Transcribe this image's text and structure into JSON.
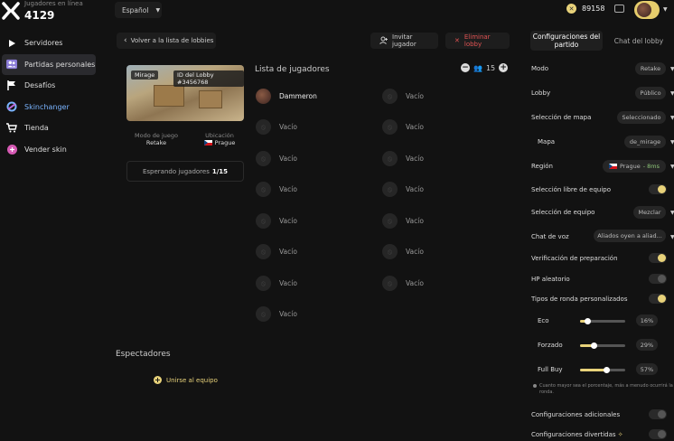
{
  "header": {
    "online_label": "Jugadores en línea",
    "online_count": "4129",
    "language": "Español",
    "coins": "89158"
  },
  "sidebar": {
    "items": [
      {
        "label": "Servidores",
        "icon": "play-icon"
      },
      {
        "label": "Partidas personales",
        "icon": "users-icon",
        "active": true
      },
      {
        "label": "Desafíos",
        "icon": "flag-icon"
      },
      {
        "label": "Skinchanger",
        "icon": "skinchanger-icon"
      },
      {
        "label": "Tienda",
        "icon": "cart-icon"
      },
      {
        "label": "Vender skin",
        "icon": "sell-skin-icon"
      }
    ]
  },
  "actions": {
    "back": "Volver a la lista de lobbies",
    "invite": "Invitar jugador",
    "delete": "Eliminar lobby"
  },
  "lobby": {
    "map": "Mirage",
    "lobby_id": "ID del Lobby #3456768",
    "mode_label": "Modo de juego",
    "mode_value": "Retake",
    "location_label": "Ubicación",
    "location_value": "Prague",
    "waiting_text": "Esperando jugadores",
    "waiting_count": "1/15"
  },
  "players": {
    "title": "Lista de jugadores",
    "max": "15",
    "filled_name": "Dammeron",
    "empty_label": "Vacío"
  },
  "spectators": {
    "title": "Espectadores",
    "join": "Unirse al equipo"
  },
  "settings": {
    "tab_active": "Configuraciones del partido",
    "tab_inactive": "Chat del lobby",
    "modo_label": "Modo",
    "modo_value": "Retake",
    "lobby_label": "Lobby",
    "lobby_value": "Público",
    "mapsel_label": "Selección de mapa",
    "mapsel_value": "Seleccionado",
    "mapa_label": "Mapa",
    "mapa_value": "de_mirage",
    "region_label": "Región",
    "region_value": "Prague",
    "region_ping": "- 8ms",
    "free_team_label": "Selección libre de equipo",
    "team_sel_label": "Selección de equipo",
    "team_sel_value": "Mezclar",
    "voice_label": "Chat de voz",
    "voice_value": "Aliados oyen a aliad...",
    "ready_label": "Verificación de preparación",
    "hp_label": "HP aleatorio",
    "rounds_label": "Tipos de ronda personalizados",
    "eco_label": "Eco",
    "eco_pct": "16%",
    "eco_value": 0.16,
    "forced_label": "Forzado",
    "forced_pct": "29%",
    "forced_value": 0.29,
    "fullbuy_label": "Full Buy",
    "fullbuy_pct": "57%",
    "fullbuy_value": 0.57,
    "note": "Cuanto mayor sea el porcentaje, más a menudo ocurrirá la ronda.",
    "additional_label": "Configuraciones adicionales",
    "fun_label": "Configuraciones divertidas"
  },
  "colors": {
    "accent": "#e8d27a",
    "danger": "#e05252",
    "link": "#7ab4ff"
  }
}
